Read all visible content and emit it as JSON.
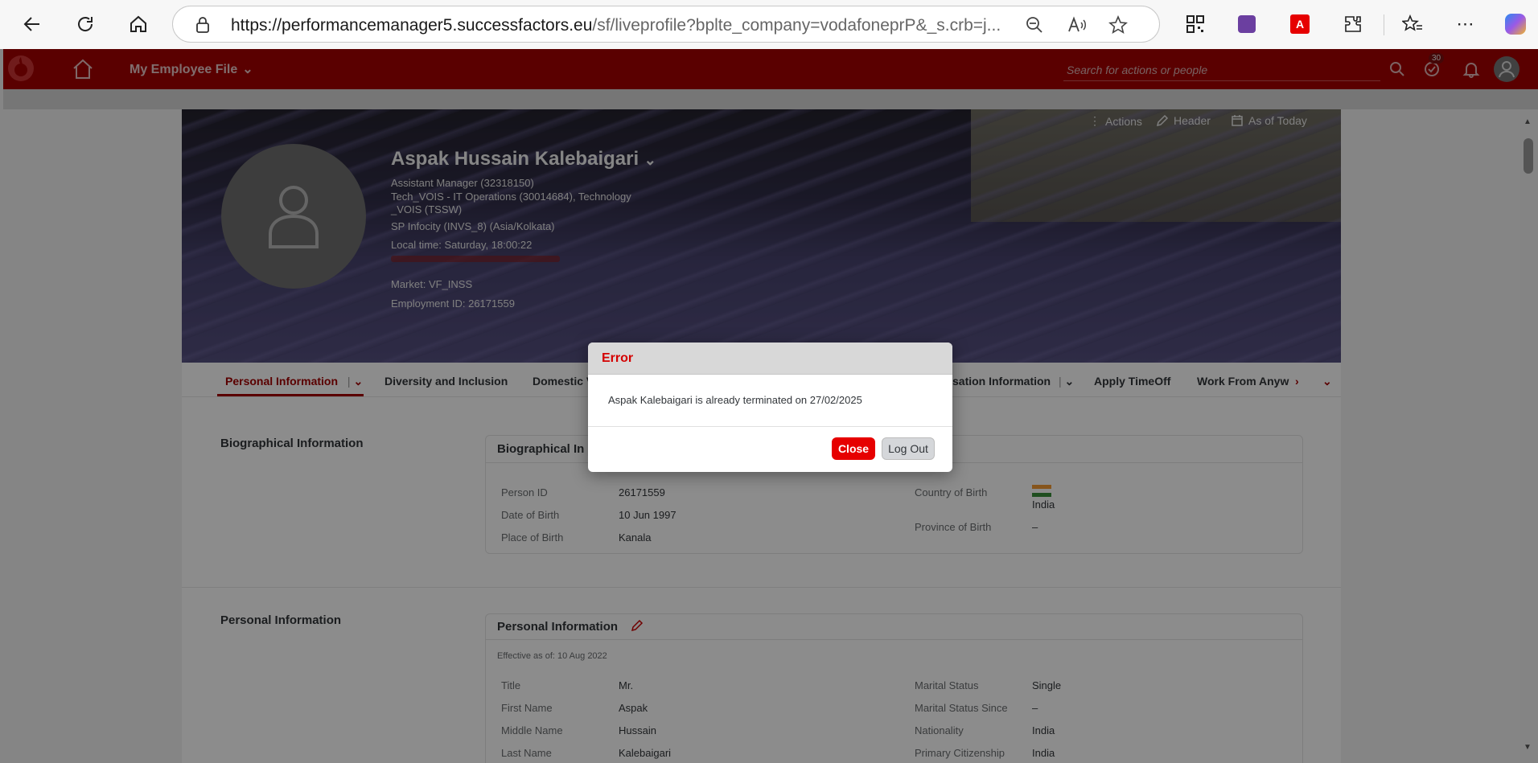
{
  "browser": {
    "url_host": "https://performancemanager5.successfactors.eu",
    "url_path": "/sf/liveprofile?bplte_company=vodafoneprP&_s.crb=j..."
  },
  "shell": {
    "title": "My Employee File",
    "search_placeholder": "Search for actions or people",
    "notification_count": "30",
    "brand_color": "#a50000"
  },
  "header": {
    "actions_label": "Actions",
    "header_label": "Header",
    "as_of_label": "As of Today",
    "name": "Aspak Hussain Kalebaigari",
    "lines": [
      "Assistant Manager (32318150)",
      "Tech_VOIS - IT Operations (30014684), Technology",
      "_VOIS (TSSW)",
      "SP Infocity (INVS_8) (Asia/Kolkata)",
      "Local time: Saturday, 18:00:22",
      "Market: VF_INSS",
      "Employment ID: 26171559"
    ]
  },
  "tabs": [
    "Personal Information",
    "Diversity and Inclusion",
    "Domestic V",
    "sation Information",
    "Apply TimeOff",
    "Work From Anyw"
  ],
  "bio": {
    "section_label": "Biographical Information",
    "card_title": "Biographical In",
    "person_id_label": "Person ID",
    "person_id": "26171559",
    "dob_label": "Date of Birth",
    "dob": "10 Jun 1997",
    "pob_label": "Place of Birth",
    "pob": "Kanala",
    "country_label": "Country of Birth",
    "country": "India",
    "province_label": "Province of Birth",
    "province": "–"
  },
  "personal": {
    "section_label": "Personal Information",
    "card_title": "Personal Information",
    "effective": "Effective as of: 10 Aug 2022",
    "left": [
      {
        "label": "Title",
        "value": "Mr."
      },
      {
        "label": "First Name",
        "value": "Aspak"
      },
      {
        "label": "Middle Name",
        "value": "Hussain"
      },
      {
        "label": "Last Name",
        "value": "Kalebaigari"
      }
    ],
    "right": [
      {
        "label": "Marital Status",
        "value": "Single"
      },
      {
        "label": "Marital Status Since",
        "value": "–"
      },
      {
        "label": "Nationality",
        "value": "India"
      },
      {
        "label": "Primary Citizenship",
        "value": "India"
      }
    ]
  },
  "dialog": {
    "title": "Error",
    "message": "Aspak Kalebaigari is already terminated on 27/02/2025",
    "close_label": "Close",
    "logout_label": "Log Out"
  }
}
